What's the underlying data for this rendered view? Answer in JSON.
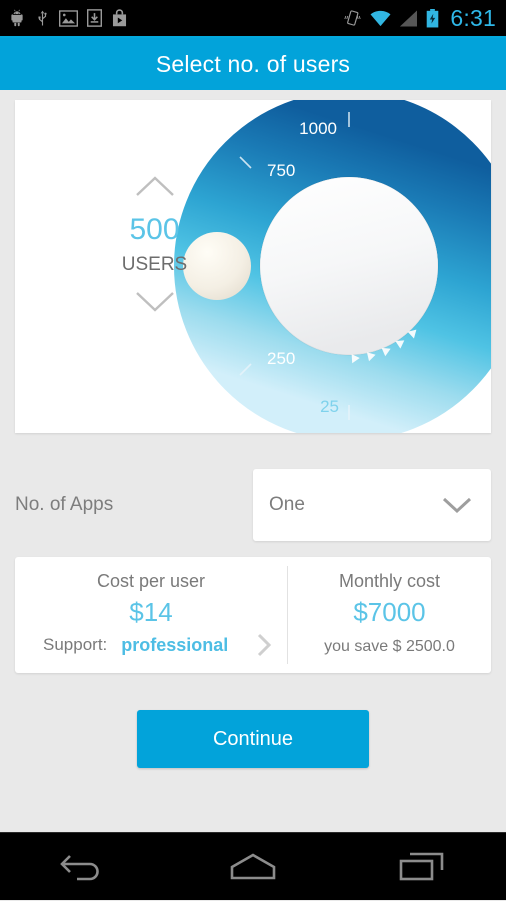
{
  "status_bar": {
    "clock": "6:31",
    "left_icons": [
      "android-robot-icon",
      "usb-icon",
      "image-icon",
      "download-icon",
      "play-store-icon"
    ],
    "right_icons": [
      "vibrate-icon",
      "wifi-icon",
      "cell-signal-icon",
      "battery-charging-icon"
    ],
    "accent_color": "#2fb8e8"
  },
  "app_bar": {
    "title": "Select no. of users",
    "background_color": "#02a3da"
  },
  "dial": {
    "value": "500",
    "unit": "USERS",
    "value_color": "#5bc4e7",
    "increment_icon": "chevron-up-icon",
    "decrement_icon": "chevron-down-icon",
    "tick_labels": [
      "1000",
      "750",
      "250",
      "25"
    ],
    "min": 25,
    "max": 1000,
    "gradient_from": "#1469a8",
    "gradient_to": "#cdeef7",
    "knob_color": "#f3eee3"
  },
  "apps_row": {
    "label": "No. of Apps",
    "selected": "One",
    "chevron_icon": "chevron-down-icon"
  },
  "cost": {
    "per_user": {
      "title": "Cost per user",
      "amount": "$14",
      "support_label": "Support:",
      "support_value": "professional",
      "chevron_icon": "chevron-right-icon"
    },
    "monthly": {
      "title": "Monthly cost",
      "amount": "$7000",
      "savings": "you save $ 2500.0"
    },
    "amount_color": "#5bc4e7"
  },
  "actions": {
    "continue_label": "Continue"
  },
  "nav_bar": {
    "buttons": [
      "back-button",
      "home-button",
      "recents-button"
    ]
  }
}
